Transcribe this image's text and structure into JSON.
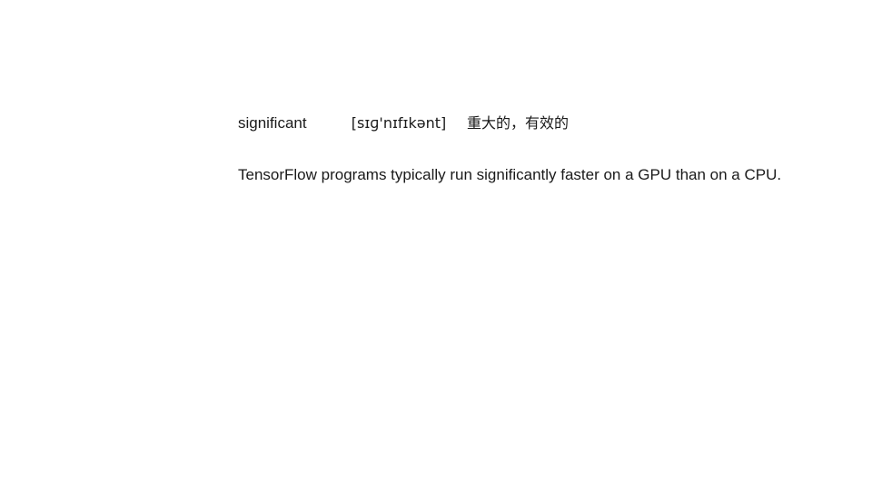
{
  "entry": {
    "word": "significant",
    "phonetic": "[sɪɡ'nɪfɪkənt]",
    "meaning": "重大的，有效的",
    "example": "TensorFlow programs typically run significantly faster on a GPU than on a CPU."
  }
}
